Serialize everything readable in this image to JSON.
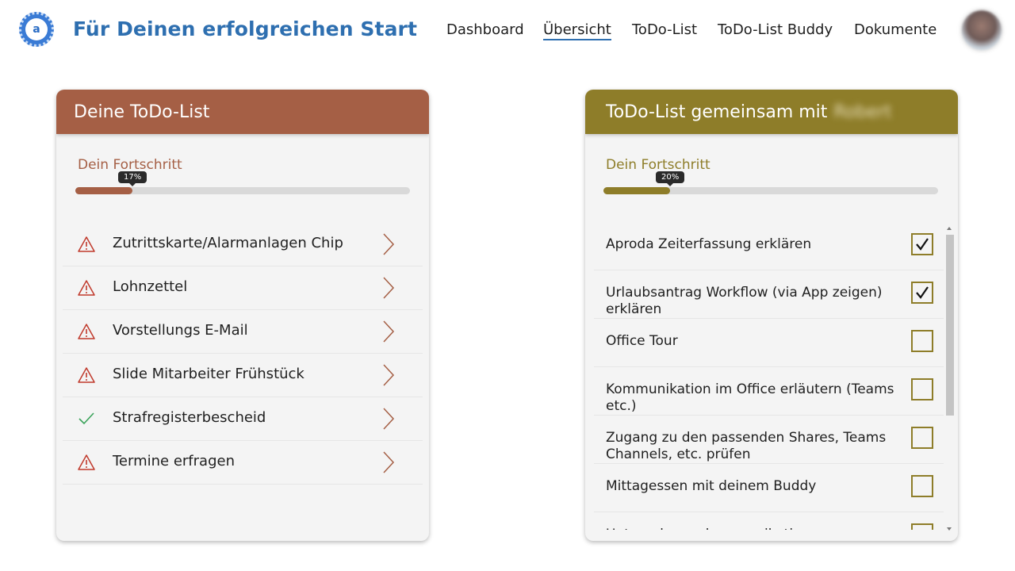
{
  "header": {
    "logo_text": "a",
    "title": "Für Deinen erfolgreichen Start",
    "nav": [
      {
        "label": "Dashboard",
        "active": false
      },
      {
        "label": "Übersicht",
        "active": true
      },
      {
        "label": "ToDo-List",
        "active": false
      },
      {
        "label": "ToDo-List Buddy",
        "active": false
      },
      {
        "label": "Dokumente",
        "active": false
      }
    ]
  },
  "left_card": {
    "title": "Deine ToDo-List",
    "progress_label": "Dein Fortschritt",
    "progress_value": 0.17,
    "progress_text": "17%",
    "items": [
      {
        "label": "Zutrittskarte/Alarmanlagen Chip",
        "status": "warning"
      },
      {
        "label": "Lohnzettel",
        "status": "warning"
      },
      {
        "label": "Vorstellungs E-Mail",
        "status": "warning"
      },
      {
        "label": "Slide Mitarbeiter Frühstück",
        "status": "warning"
      },
      {
        "label": "Strafregisterbescheid",
        "status": "done"
      },
      {
        "label": "Termine erfragen",
        "status": "warning"
      }
    ]
  },
  "right_card": {
    "title": "ToDo-List gemeinsam mit",
    "buddy_name": "Robert",
    "progress_label": "Dein Fortschritt",
    "progress_value": 0.2,
    "progress_text": "20%",
    "items": [
      {
        "label": "Aproda Zeiterfassung erklären",
        "checked": true
      },
      {
        "label": "Urlaubsantrag Workflow (via App zeigen) erklären",
        "checked": true
      },
      {
        "label": "Office Tour",
        "checked": false
      },
      {
        "label": "Kommunikation im Office erläutern (Teams etc.)",
        "checked": false
      },
      {
        "label": "Zugang zu den passenden Shares, Teams Channels, etc. prüfen",
        "checked": false
      },
      {
        "label": "Mittagessen mit deinem Buddy",
        "checked": false
      },
      {
        "label": "Unternehmenskommunikation",
        "checked": false
      }
    ]
  },
  "colors": {
    "brand_blue": "#2e6fb0",
    "left_accent": "#a55f45",
    "right_accent": "#8e7d29",
    "warning_red": "#c0392b",
    "done_green": "#3aa35a"
  },
  "icons": {
    "warning": "warning-triangle-icon",
    "done": "checkmark-icon",
    "chevron": "chevron-right-icon",
    "check": "checkbox-check-icon"
  }
}
